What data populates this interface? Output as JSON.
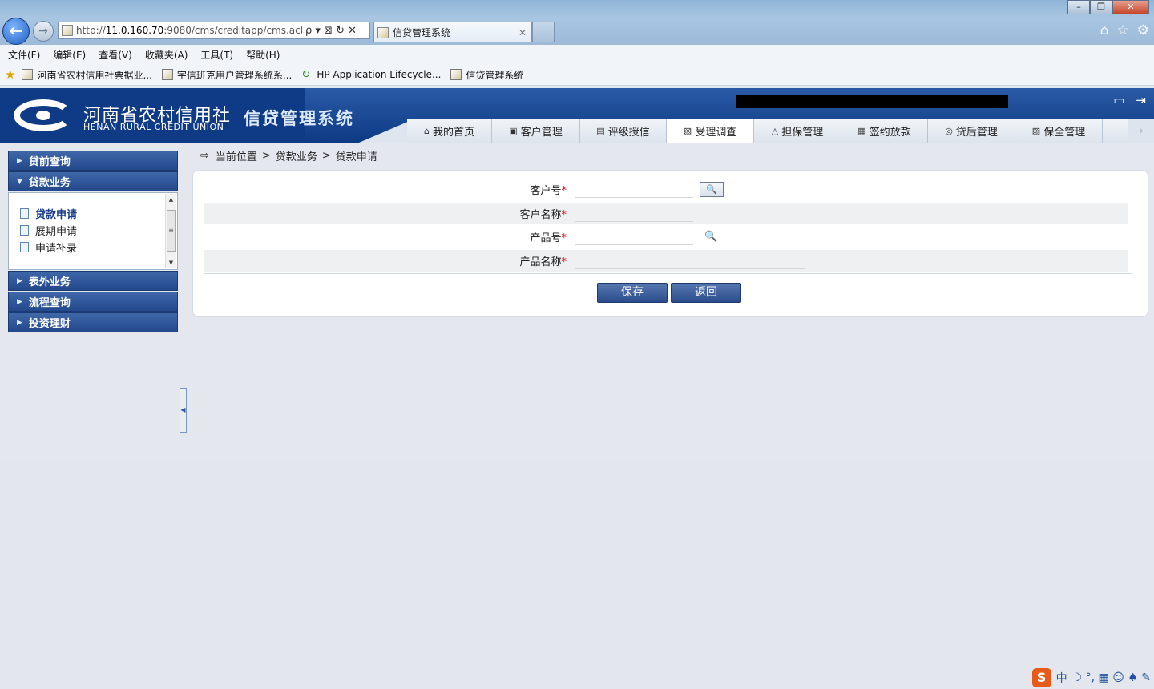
{
  "browser": {
    "url_prefix": "http://",
    "url_host": "11.0.160.70",
    "url_rest": ":9080/cms/creditapp/cms.actic",
    "url_controls": "ρ ▾ ⊠ ↻ ✕",
    "tab_title": "信贷管理系统",
    "tab_close": "✕",
    "win_min": "–",
    "win_max": "❐",
    "win_close": "✕",
    "home_icon": "⌂",
    "favorites_icon": "☆",
    "tools_icon": "⚙",
    "back_icon": "←",
    "forward_icon": "→"
  },
  "menu": [
    "文件(F)",
    "编辑(E)",
    "查看(V)",
    "收藏夹(A)",
    "工具(T)",
    "帮助(H)"
  ],
  "favorites": [
    "河南省农村信用社票据业...",
    "宇信班克用户管理系统系...",
    "HP Application Lifecycle...",
    "信贷管理系统"
  ],
  "header": {
    "org_cn": "河南省农村信用社",
    "org_en": "HENAN RURAL CREDIT UNION",
    "system_title": "信贷管理系统"
  },
  "nav_tabs": [
    {
      "label": "我的首页",
      "icon": "home-icon",
      "glyph": "⌂"
    },
    {
      "label": "客户管理",
      "icon": "customer-icon",
      "glyph": "▣"
    },
    {
      "label": "评级授信",
      "icon": "rating-icon",
      "glyph": "▤"
    },
    {
      "label": "受理调查",
      "icon": "survey-icon",
      "glyph": "▧",
      "active": true
    },
    {
      "label": "担保管理",
      "icon": "guarantee-icon",
      "glyph": "△"
    },
    {
      "label": "签约放款",
      "icon": "contract-icon",
      "glyph": "▦"
    },
    {
      "label": "贷后管理",
      "icon": "postloan-icon",
      "glyph": "◎"
    },
    {
      "label": "保全管理",
      "icon": "preservation-icon",
      "glyph": "▨"
    }
  ],
  "nav_next": "›",
  "sidebar": {
    "groups": [
      "贷前查询",
      "贷款业务",
      "表外业务",
      "流程查询",
      "投资理财"
    ],
    "items": [
      "贷款申请",
      "展期申请",
      "申请补录"
    ]
  },
  "breadcrumb": {
    "label": "当前位置",
    "sep": ">",
    "level1": "贷款业务",
    "level2": "贷款申请"
  },
  "form": {
    "customer_no": "客户号",
    "customer_name": "客户名称",
    "product_no": "产品号",
    "product_name": "产品名称",
    "required_mark": "*",
    "search_glyph": "🔍"
  },
  "buttons": {
    "save": "保存",
    "back": "返回"
  },
  "ime": {
    "logo": "S",
    "mode": "中",
    "icons": "☽ °, ▦ ☺ ♠ ✎"
  }
}
